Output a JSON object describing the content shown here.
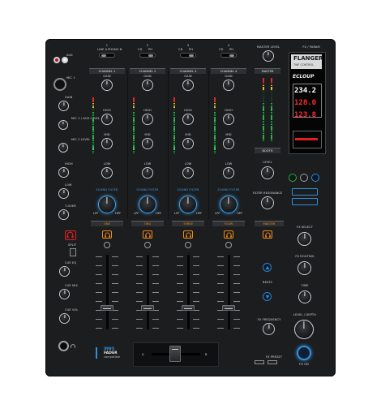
{
  "top": {
    "aux_label": "AUX",
    "mic_label": "MIC 1",
    "gain_label": "GAIN",
    "master_level": "MASTER LEVEL",
    "fx_param": "FX / PARAM",
    "inputs": [
      {
        "labels": [
          "LINE A",
          "PHONO B"
        ],
        "num": "1"
      },
      {
        "labels": [
          "CD",
          "PH"
        ],
        "num": "2"
      },
      {
        "labels": [
          "CD",
          "PH"
        ],
        "num": "3"
      },
      {
        "labels": [
          "CD",
          "PH"
        ],
        "num": "4"
      }
    ]
  },
  "left": {
    "mic_level": "MIC 1 / AUX LEVEL",
    "mic2_level": "MIC 2 LEVEL",
    "high": "HIGH",
    "low": "LOW",
    "split": "SPLIT",
    "cue_eq": "CUE EQ",
    "cue_mix": "CUE MIX",
    "cue_vol": "CUE VOL",
    "talkover": "T-OVER"
  },
  "channels": [
    {
      "title": "CHANNEL 1",
      "bottom": "ONE"
    },
    {
      "title": "CHANNEL 2",
      "bottom": "TWO"
    },
    {
      "title": "CHANNEL 3",
      "bottom": "THREE"
    },
    {
      "title": "CHANNEL 4",
      "bottom": "FOUR"
    }
  ],
  "channel_labels": {
    "gain": "GAIN",
    "high": "HIGH",
    "mid": "MID",
    "low": "LOW",
    "sound_filter": "SOUND FILTER",
    "lpf": "LPF",
    "hpf": "HPF"
  },
  "master": {
    "title": "MASTER",
    "booth": "BOOTH",
    "level": "LEVEL",
    "filter_resonance": "FILTER RESONANCE",
    "cue_master": "MASTER",
    "beats": "BEATS",
    "fx_frequency": "FX FREQUENCY",
    "fx_preset": "FX PRESET"
  },
  "fx": {
    "screen_top": "FLANGER",
    "screen_sub": "TWF CONTROL",
    "brand": "ECLOUP",
    "vals": [
      "234.2",
      "128.0",
      "123.8"
    ],
    "fx_select": "FX SELECT",
    "fx_routing": "FX ROUTING",
    "time": "TIME",
    "level_depth": "LEVEL / DEPTH",
    "fx_on": "FX ON"
  },
  "brand": {
    "line1": "INNO",
    "line2": "FADER",
    "line3": "compatible"
  },
  "crossfader": {
    "a_label": "A",
    "b_label": "B"
  },
  "colors": {
    "accent_orange": "#f28b1c",
    "accent_blue": "#2f8fd8",
    "red": "#e02020",
    "green": "#2aa84a"
  }
}
